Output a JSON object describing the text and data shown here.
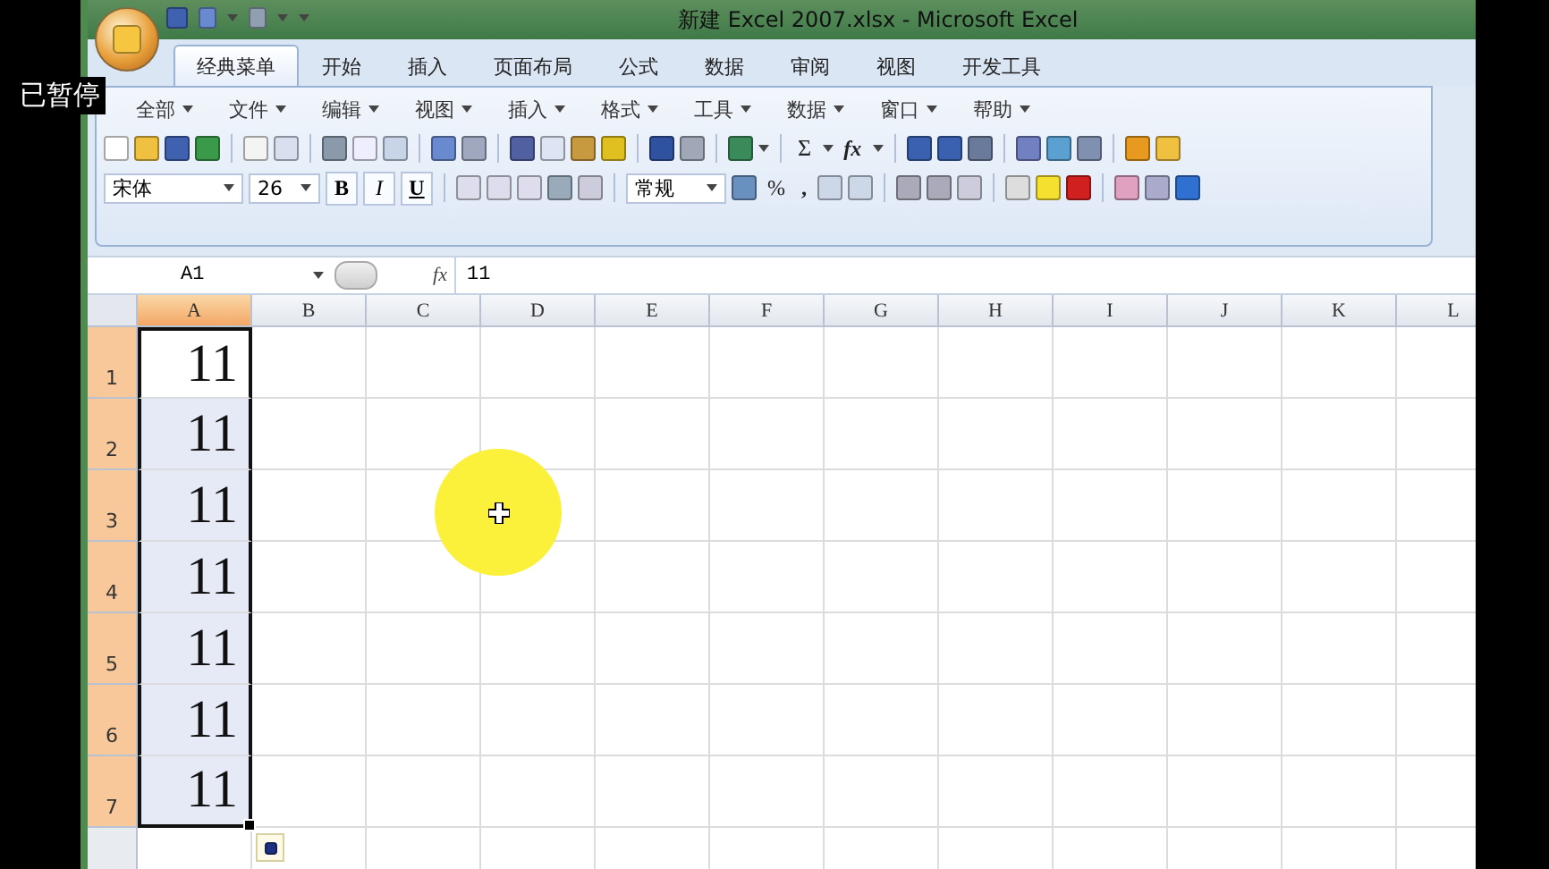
{
  "overlay": {
    "status": "已暂停"
  },
  "window": {
    "title": "新建 Excel 2007.xlsx - Microsoft Excel"
  },
  "ribbon_tabs": [
    {
      "label": "经典菜单",
      "selected": true
    },
    {
      "label": "开始",
      "selected": false
    },
    {
      "label": "插入",
      "selected": false
    },
    {
      "label": "页面布局",
      "selected": false
    },
    {
      "label": "公式",
      "selected": false
    },
    {
      "label": "数据",
      "selected": false
    },
    {
      "label": "审阅",
      "selected": false
    },
    {
      "label": "视图",
      "selected": false
    },
    {
      "label": "开发工具",
      "selected": false
    }
  ],
  "menus": [
    "全部",
    "文件",
    "编辑",
    "视图",
    "插入",
    "格式",
    "工具",
    "数据",
    "窗口",
    "帮助"
  ],
  "standard_toolbar": {
    "sum": "Σ",
    "function": "fx"
  },
  "format_toolbar": {
    "font": "宋体",
    "size": "26",
    "bold": "B",
    "italic": "I",
    "underline": "U",
    "number_format": "常规",
    "percent": "%",
    "comma": ","
  },
  "formula_bar": {
    "name_box": "A1",
    "function": "fx",
    "formula": "11"
  },
  "sheet": {
    "columns": [
      {
        "label": "A",
        "selected": true
      },
      {
        "label": "B",
        "selected": false
      },
      {
        "label": "C",
        "selected": false
      },
      {
        "label": "D",
        "selected": false
      },
      {
        "label": "E",
        "selected": false
      },
      {
        "label": "F",
        "selected": false
      },
      {
        "label": "G",
        "selected": false
      },
      {
        "label": "H",
        "selected": false
      },
      {
        "label": "I",
        "selected": false
      },
      {
        "label": "J",
        "selected": false
      },
      {
        "label": "K",
        "selected": false
      },
      {
        "label": "L",
        "selected": false
      }
    ],
    "rows": [
      {
        "label": "1",
        "selected": true,
        "cell": {
          "value": "11",
          "selected": true,
          "active": true
        }
      },
      {
        "label": "2",
        "selected": true,
        "cell": {
          "value": "11",
          "selected": true,
          "active": false
        }
      },
      {
        "label": "3",
        "selected": true,
        "cell": {
          "value": "11",
          "selected": true,
          "active": false
        }
      },
      {
        "label": "4",
        "selected": true,
        "cell": {
          "value": "11",
          "selected": true,
          "active": false
        }
      },
      {
        "label": "5",
        "selected": true,
        "cell": {
          "value": "11",
          "selected": true,
          "active": false
        }
      },
      {
        "label": "6",
        "selected": true,
        "cell": {
          "value": "11",
          "selected": true,
          "active": false
        }
      },
      {
        "label": "7",
        "selected": true,
        "cell": {
          "value": "11",
          "selected": true,
          "active": false
        }
      }
    ]
  }
}
